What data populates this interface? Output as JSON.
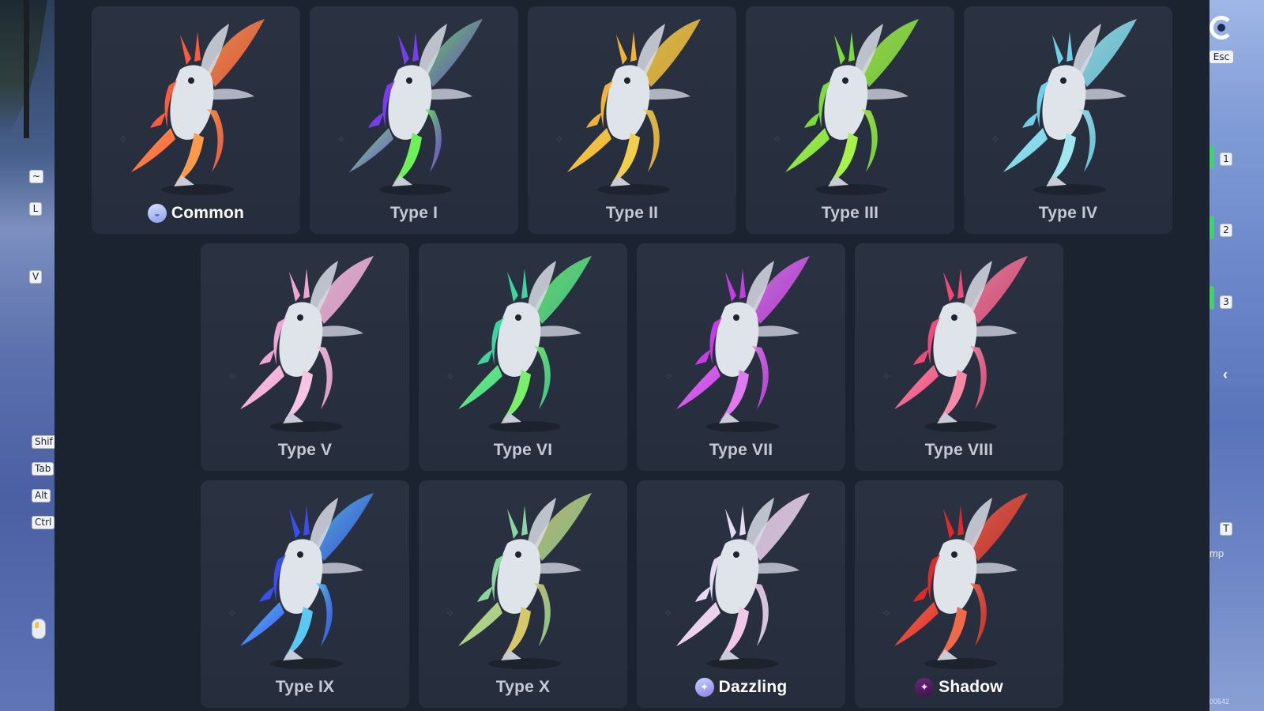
{
  "left_keys": [
    "~",
    "L",
    "V",
    "Shif",
    "Tab",
    "Alt",
    "Ctrl"
  ],
  "right_hud": {
    "esc_label": "Esc",
    "number_keys": [
      "1",
      "2",
      "3"
    ],
    "t_key": "T",
    "side_text": "mp",
    "corner_id": "00542"
  },
  "cards": [
    {
      "label": "Common",
      "badge": "common",
      "accent": "#ff5a3c",
      "accent2": "#ff9a4a"
    },
    {
      "label": "Type I",
      "badge": null,
      "accent": "#7a3cf0",
      "accent2": "#6df05a"
    },
    {
      "label": "Type II",
      "badge": null,
      "accent": "#f2b233",
      "accent2": "#f0d04a"
    },
    {
      "label": "Type III",
      "badge": null,
      "accent": "#7bdc3c",
      "accent2": "#a8f04a"
    },
    {
      "label": "Type IV",
      "badge": null,
      "accent": "#6fd0e6",
      "accent2": "#a0e6f0"
    },
    {
      "label": "Type V",
      "badge": null,
      "accent": "#f0a6d2",
      "accent2": "#f7c4e4"
    },
    {
      "label": "Type VI",
      "badge": null,
      "accent": "#3ed49c",
      "accent2": "#7af06a"
    },
    {
      "label": "Type VII",
      "badge": null,
      "accent": "#c63ce6",
      "accent2": "#e07af0"
    },
    {
      "label": "Type VIII",
      "badge": null,
      "accent": "#f04a7a",
      "accent2": "#f78aa8"
    },
    {
      "label": "Type IX",
      "badge": null,
      "accent": "#3a4ef0",
      "accent2": "#5ac8f0"
    },
    {
      "label": "Type X",
      "badge": null,
      "accent": "#8ad6a0",
      "accent2": "#d6c86a"
    },
    {
      "label": "Dazzling",
      "badge": "dazzling",
      "accent": "#e4dcf2",
      "accent2": "#f2c8e8"
    },
    {
      "label": "Shadow",
      "badge": "shadow",
      "accent": "#e02a2a",
      "accent2": "#f06a4a"
    }
  ]
}
